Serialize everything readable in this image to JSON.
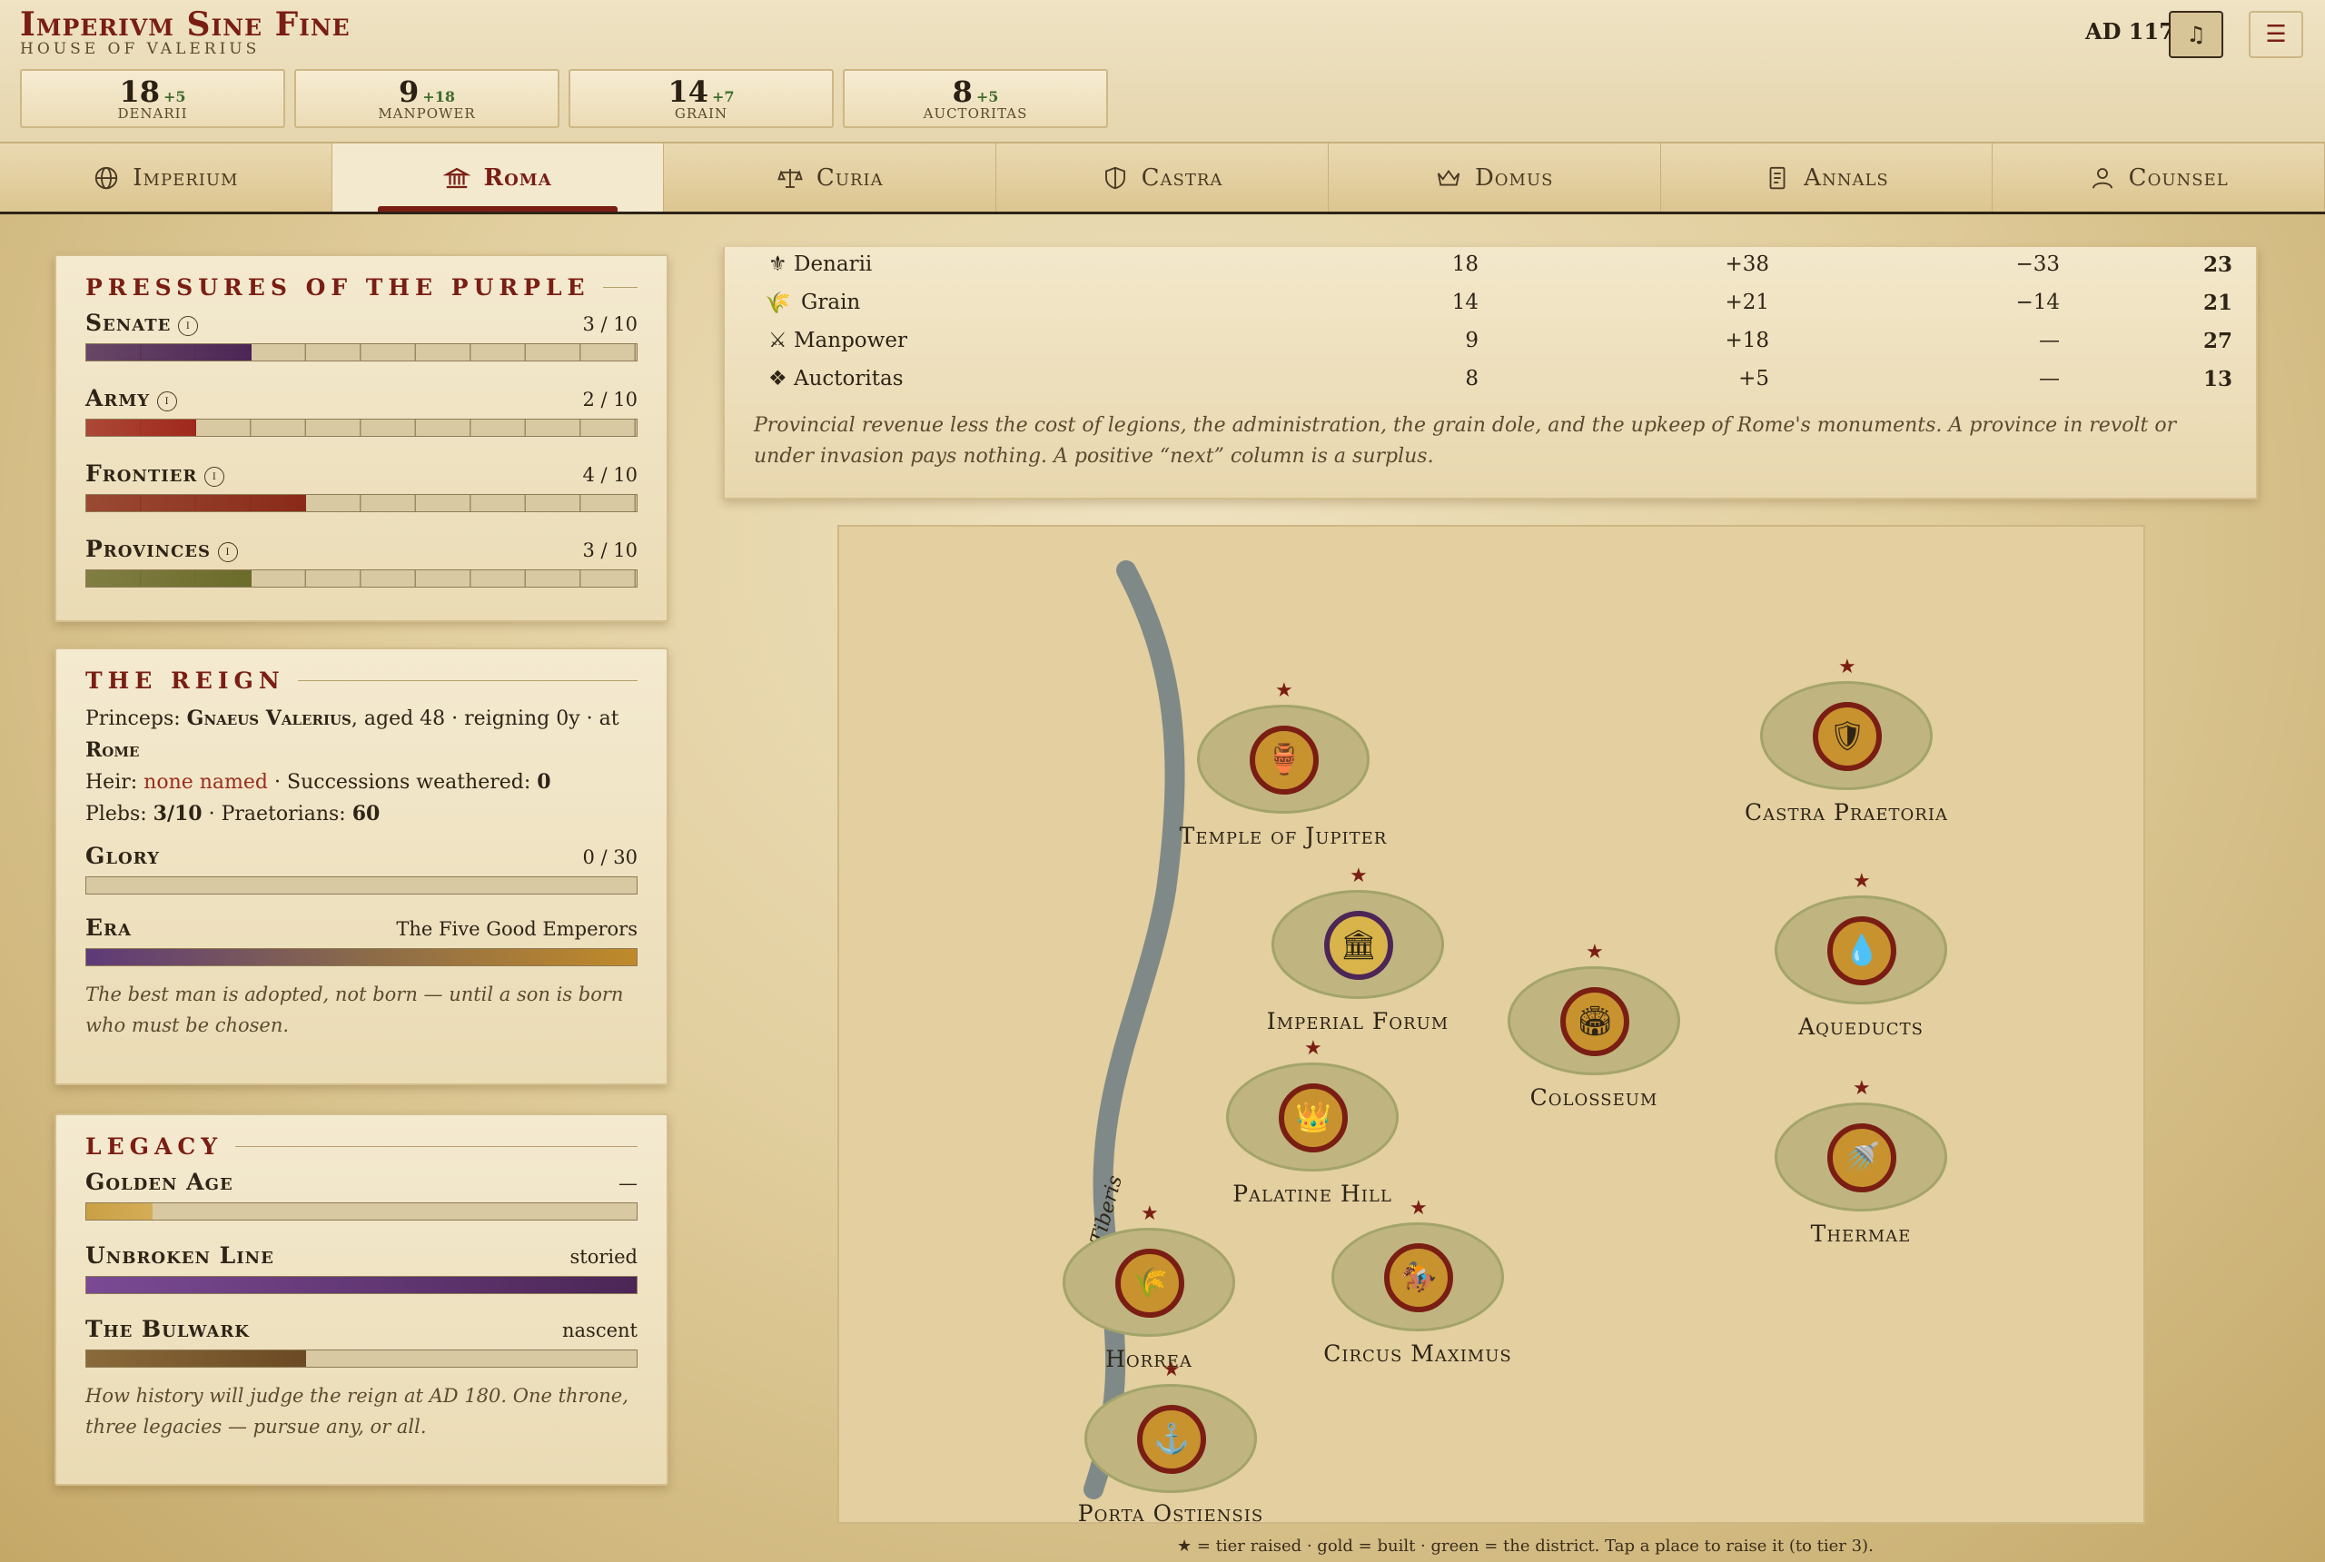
{
  "header": {
    "title": "Imperivm Sine Fine",
    "subtitle": "HOUSE OF VALERIUS",
    "year": "AD 117",
    "music_icon": "♫",
    "menu_icon": "☰"
  },
  "resources": [
    {
      "value": "18",
      "delta": "+5",
      "name": "DENARII"
    },
    {
      "value": "9",
      "delta": "+18",
      "name": "MANPOWER"
    },
    {
      "value": "14",
      "delta": "+7",
      "name": "GRAIN"
    },
    {
      "value": "8",
      "delta": "+5",
      "name": "AUCTORITAS"
    }
  ],
  "tabs": [
    {
      "label": "Imperium",
      "icon": "globe-icon"
    },
    {
      "label": "Roma",
      "icon": "temple-icon"
    },
    {
      "label": "Curia",
      "icon": "scales-icon"
    },
    {
      "label": "Castra",
      "icon": "shield-icon"
    },
    {
      "label": "Domus",
      "icon": "crown-icon"
    },
    {
      "label": "Annals",
      "icon": "scroll-icon"
    },
    {
      "label": "Counsel",
      "icon": "person-icon"
    }
  ],
  "pressures": {
    "title": "PRESSURES OF THE PURPLE",
    "items": [
      {
        "label": "Senate",
        "value": "3 / 10",
        "level": 0.3,
        "color": "#4c2656"
      },
      {
        "label": "Army",
        "value": "2 / 10",
        "level": 0.2,
        "color": "#a0281c"
      },
      {
        "label": "Frontier",
        "value": "4 / 10",
        "level": 0.4,
        "color": "#8a2a18"
      },
      {
        "label": "Provinces",
        "value": "3 / 10",
        "level": 0.3,
        "color": "#6b6b2a"
      }
    ]
  },
  "reign": {
    "title": "THE REIGN",
    "princeps_label": "Princeps:",
    "princeps_name": "Gnaeus Valerius",
    "age_text": ", aged 48 · reigning 0y · at",
    "capital": "Rome",
    "heir_label": "Heir:",
    "heir_value": "none named",
    "successions_label": "Successions weathered:",
    "successions_value": "0",
    "plebs_label": "Plebs:",
    "plebs_value": "3/10",
    "praetorians_label": "Praetorians:",
    "praetorians_value": "60",
    "glory_label": "Glory",
    "glory_value": "0 / 30",
    "glory_level": 0.0,
    "era_label": "Era",
    "era_value": "The Five Good Emperors",
    "note": "The best man is adopted, not born — until a son is born who must be chosen."
  },
  "legacy": {
    "title": "LEGACY",
    "items": [
      {
        "label": "Golden Age",
        "value": "—",
        "level": 0.12
      },
      {
        "label": "Unbroken Line",
        "value": "storied",
        "level": 1.0
      },
      {
        "label": "The Bulwark",
        "value": "nascent",
        "level": 0.4
      }
    ],
    "note": "How history will judge the reign at AD 180. One throne, three legacies — pursue any, or all."
  },
  "ledger": {
    "rows": [
      {
        "icon": "⚜",
        "name": "Denarii",
        "now": "18",
        "income": "+38",
        "upkeep": "−33",
        "next": "23"
      },
      {
        "icon": "🌾",
        "name": "Grain",
        "now": "14",
        "income": "+21",
        "upkeep": "−14",
        "next": "21"
      },
      {
        "icon": "⚔",
        "name": "Manpower",
        "now": "9",
        "income": "+18",
        "upkeep": "—",
        "next": "27"
      },
      {
        "icon": "❖",
        "name": "Auctoritas",
        "now": "8",
        "income": "+5",
        "upkeep": "—",
        "next": "13"
      }
    ],
    "note": "Provincial revenue less the cost of legions, the administration, the grain dole, and the upkeep of Rome's monuments. A province in revolt or under invasion pays nothing. A positive “next” column is a surplus."
  },
  "map": {
    "river_label": "Tiberis",
    "places": [
      {
        "name": "Temple of Jupiter",
        "glyph": "🏺"
      },
      {
        "name": "Castra Praetoria",
        "glyph": "🛡"
      },
      {
        "name": "Imperial Forum",
        "glyph": "🏛"
      },
      {
        "name": "Aqueducts",
        "glyph": "💧"
      },
      {
        "name": "Colosseum",
        "glyph": "🏟"
      },
      {
        "name": "Palatine Hill",
        "glyph": "👑"
      },
      {
        "name": "Thermae",
        "glyph": "🚿"
      },
      {
        "name": "Horrea",
        "glyph": "🌾"
      },
      {
        "name": "Circus Maximus",
        "glyph": "🏇"
      },
      {
        "name": "Porta Ostiensis",
        "glyph": "⚓"
      }
    ],
    "star_glyph": "★",
    "legend": "★ = tier raised · gold = built · green = the district. Tap a place to raise it (to tier 3)."
  }
}
